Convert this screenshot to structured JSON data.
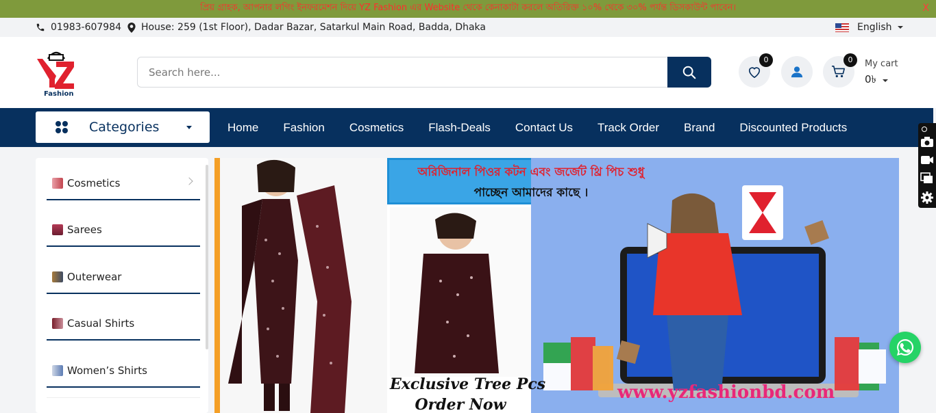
{
  "promo": {
    "text": "প্রিয় গ্রাহক, আপনার লগিং ইনফরমেশন দিয়ে YZ Fashion এর Website থেকে কেনাকাটা করলে অতিরিক্ত ১০% থেকে ৩০% পর্যন্ত ডিসকাউন্ট পাবেন।",
    "close": "X"
  },
  "topbar": {
    "phone": "01983-607984",
    "address": "House: 259 (1st Floor), Dadar Bazar, Satarkul Main Road, Badda, Dhaka",
    "language": "English"
  },
  "logo": {
    "letters": "YZ",
    "sub": "Fashion"
  },
  "search": {
    "placeholder": "Search here..."
  },
  "header": {
    "wishlist_count": "0",
    "cart_count": "0",
    "cart_label": "My cart",
    "cart_total": "0৳"
  },
  "nav": {
    "categories_label": "Categories",
    "items": [
      "Home",
      "Fashion",
      "Cosmetics",
      "Flash-Deals",
      "Contact Us",
      "Track Order",
      "Brand",
      "Discounted Products"
    ]
  },
  "categories": [
    "Cosmetics",
    "Sarees",
    "Outerwear",
    "Casual Shirts",
    "Women’s Shirts"
  ],
  "banner": {
    "headline1": "অরিজিনাল পিওর কটন এবং জর্জেট থ্রি পিচ শুধু",
    "headline2": "পাচ্ছেন আমাদের কাছে ।",
    "promo1": "Exclusive Tree Pcs",
    "promo2": "Order Now",
    "website": "www.yzfashionbd.com",
    "bag_logo": "YZ",
    "bag_sub": "Fashion"
  },
  "colors": {
    "brand_navy": "#07305e",
    "promo_bg": "#7f9a3c",
    "promo_text": "#ff2d2d",
    "whatsapp": "#25d366"
  }
}
